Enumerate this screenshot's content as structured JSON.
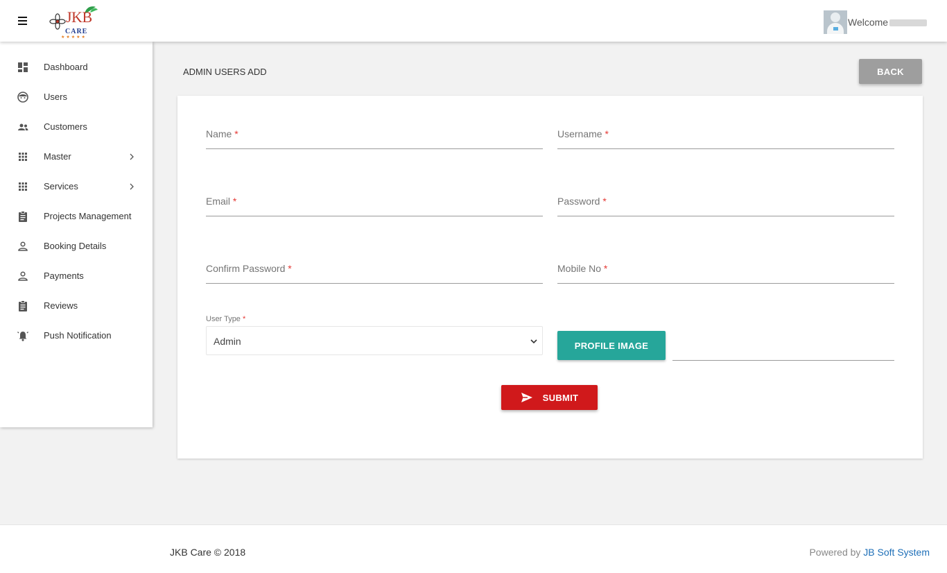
{
  "app": {
    "logo_text": "JKB",
    "logo_subtext": "CARE",
    "logo_stars": "★★★★★",
    "welcome_text": "Welcome"
  },
  "sidebar": {
    "items": [
      {
        "label": "Dashboard",
        "icon": "dashboard-icon"
      },
      {
        "label": "Users",
        "icon": "face-icon"
      },
      {
        "label": "Customers",
        "icon": "people-icon"
      },
      {
        "label": "Master",
        "icon": "grid-icon",
        "has_submenu": true
      },
      {
        "label": "Services",
        "icon": "grid-icon",
        "has_submenu": true
      },
      {
        "label": "Projects Management",
        "icon": "clipboard-icon"
      },
      {
        "label": "Booking Details",
        "icon": "person-icon"
      },
      {
        "label": "Payments",
        "icon": "person-icon"
      },
      {
        "label": "Reviews",
        "icon": "clipboard-icon"
      },
      {
        "label": "Push Notification",
        "icon": "bell-icon"
      }
    ]
  },
  "main": {
    "page_title": "ADMIN USERS ADD",
    "back_label": "BACK",
    "form": {
      "required_mark": "*",
      "name_label": "Name",
      "username_label": "Username",
      "email_label": "Email",
      "password_label": "Password",
      "confirm_password_label": "Confirm Password",
      "mobile_label": "Mobile No",
      "user_type_label": "User Type",
      "user_type_value": "Admin",
      "profile_image_label": "PROFILE IMAGE",
      "submit_label": "SUBMIT"
    }
  },
  "footer": {
    "copyright": "JKB Care © 2018",
    "powered_prefix": "Powered by",
    "powered_link": "JB Soft System"
  },
  "colors": {
    "accent_teal": "#26a69a",
    "submit_red": "#d0191b",
    "required_red": "#e53935",
    "link_blue": "#1e6fb8",
    "back_gray": "#9e9e9e"
  }
}
